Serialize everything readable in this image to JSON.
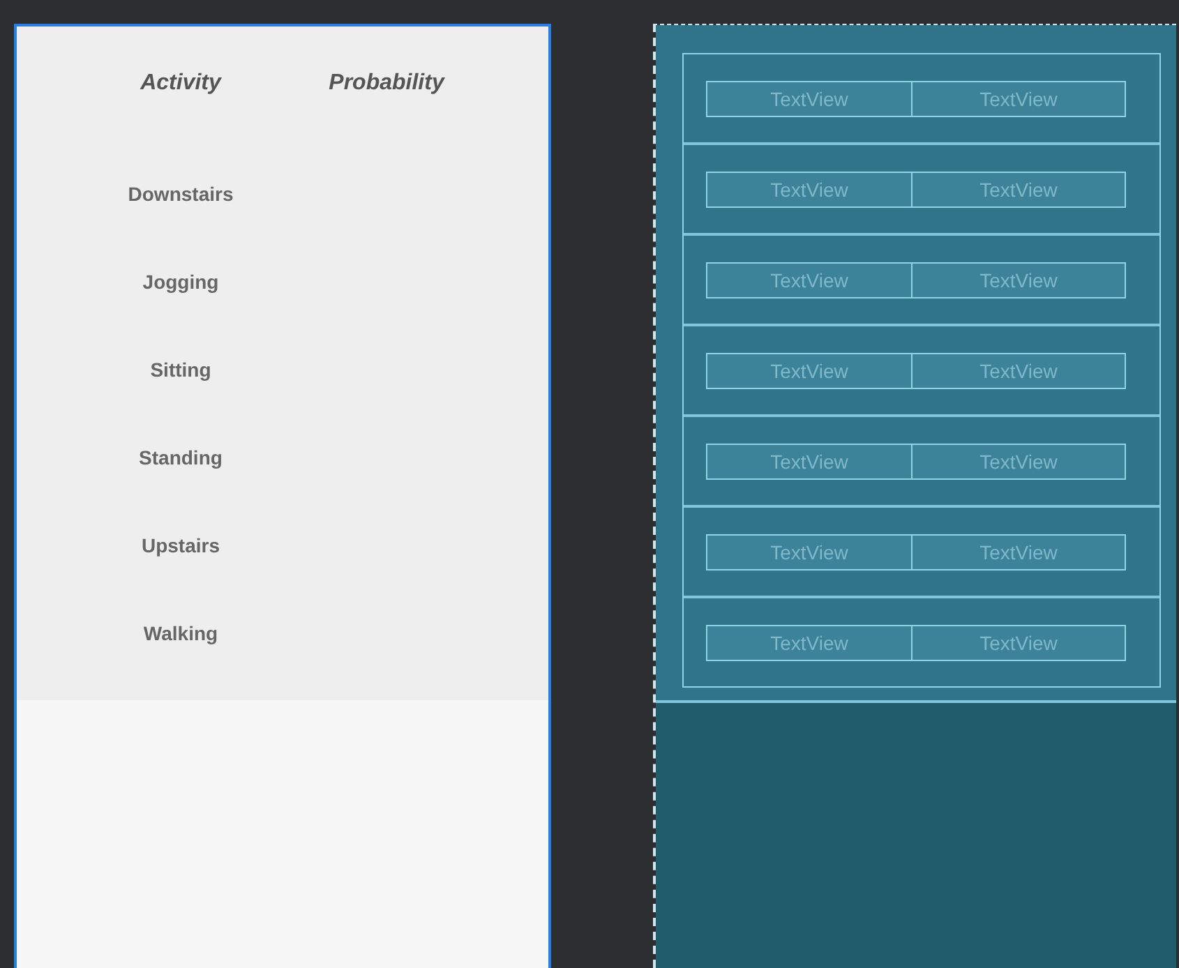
{
  "design_view": {
    "headers": [
      "Activity",
      "Probability"
    ],
    "rows": [
      {
        "activity": "Downstairs"
      },
      {
        "activity": "Jogging"
      },
      {
        "activity": "Sitting"
      },
      {
        "activity": "Standing"
      },
      {
        "activity": "Upstairs"
      },
      {
        "activity": "Walking"
      }
    ]
  },
  "blueprint_view": {
    "rows": [
      {
        "cells": [
          "TextView",
          "TextView"
        ]
      },
      {
        "cells": [
          "TextView",
          "TextView"
        ]
      },
      {
        "cells": [
          "TextView",
          "TextView"
        ]
      },
      {
        "cells": [
          "TextView",
          "TextView"
        ]
      },
      {
        "cells": [
          "TextView",
          "TextView"
        ]
      },
      {
        "cells": [
          "TextView",
          "TextView"
        ]
      },
      {
        "cells": [
          "TextView",
          "TextView"
        ]
      }
    ]
  }
}
